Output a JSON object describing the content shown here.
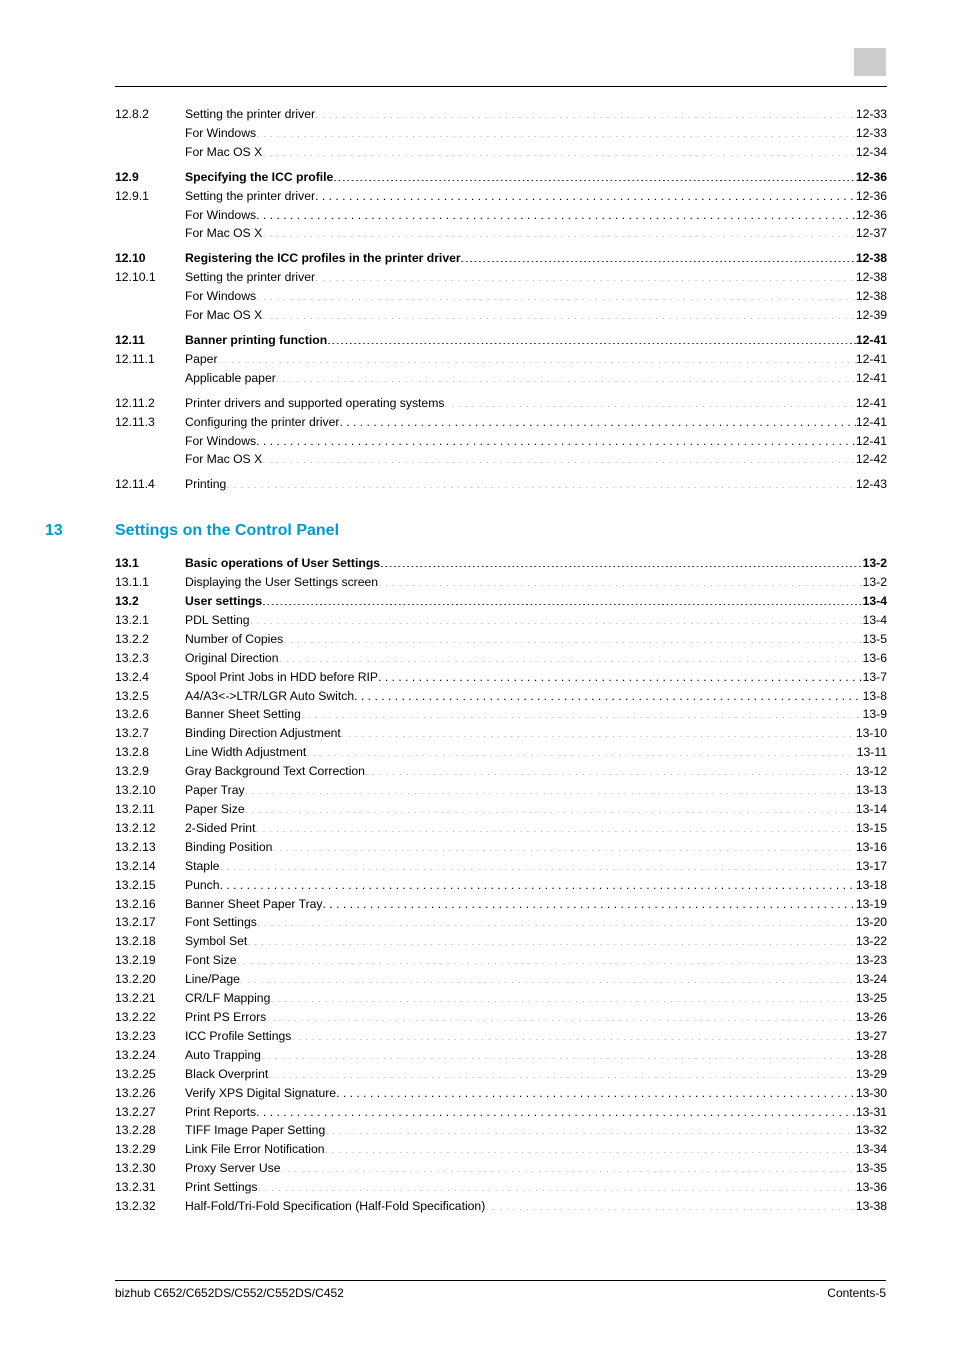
{
  "footer": {
    "product": "bizhub C652/C652DS/C552/C552DS/C452",
    "page": "Contents-5"
  },
  "section13": {
    "num": "13",
    "title": "Settings on the Control Panel"
  },
  "entries": [
    {
      "num": "12.8.2",
      "title": "Setting the printer driver",
      "pg": "12-33",
      "bold": false,
      "gapBefore": false
    },
    {
      "num": "",
      "title": "For Windows",
      "pg": "12-33",
      "bold": false
    },
    {
      "num": "",
      "title": "For Mac OS X",
      "pg": "12-34",
      "bold": false
    },
    {
      "num": "12.9",
      "title": "Specifying the ICC profile",
      "pg": "12-36",
      "bold": true,
      "gapBefore": true
    },
    {
      "num": "12.9.1",
      "title": "Setting the printer driver",
      "pg": "12-36",
      "bold": false
    },
    {
      "num": "",
      "title": "For Windows",
      "pg": "12-36",
      "bold": false
    },
    {
      "num": "",
      "title": "For Mac OS X",
      "pg": "12-37",
      "bold": false
    },
    {
      "num": "12.10",
      "title": "Registering the ICC profiles in the printer driver",
      "pg": "12-38",
      "bold": true,
      "gapBefore": true
    },
    {
      "num": "12.10.1",
      "title": "Setting the printer driver",
      "pg": "12-38",
      "bold": false
    },
    {
      "num": "",
      "title": "For Windows",
      "pg": "12-38",
      "bold": false
    },
    {
      "num": "",
      "title": "For Mac OS X",
      "pg": "12-39",
      "bold": false
    },
    {
      "num": "12.11",
      "title": "Banner printing function",
      "pg": "12-41",
      "bold": true,
      "gapBefore": true
    },
    {
      "num": "12.11.1",
      "title": "Paper",
      "pg": "12-41",
      "bold": false
    },
    {
      "num": "",
      "title": "Applicable paper",
      "pg": "12-41",
      "bold": false
    },
    {
      "num": "12.11.2",
      "title": "Printer drivers and supported operating systems",
      "pg": "12-41",
      "bold": false,
      "gapBefore": true
    },
    {
      "num": "12.11.3",
      "title": "Configuring the printer driver",
      "pg": "12-41",
      "bold": false
    },
    {
      "num": "",
      "title": "For Windows",
      "pg": "12-41",
      "bold": false
    },
    {
      "num": "",
      "title": "For Mac OS X",
      "pg": "12-42",
      "bold": false
    },
    {
      "num": "12.11.4",
      "title": "Printing",
      "pg": "12-43",
      "bold": false,
      "gapBefore": true
    }
  ],
  "entries13": [
    {
      "num": "13.1",
      "title": "Basic operations of User Settings",
      "pg": "13-2",
      "bold": true
    },
    {
      "num": "13.1.1",
      "title": "Displaying the User Settings screen",
      "pg": "13-2",
      "bold": false
    },
    {
      "num": "13.2",
      "title": "User settings",
      "pg": "13-4",
      "bold": true
    },
    {
      "num": "13.2.1",
      "title": "PDL Setting",
      "pg": "13-4",
      "bold": false
    },
    {
      "num": "13.2.2",
      "title": "Number of Copies",
      "pg": "13-5",
      "bold": false
    },
    {
      "num": "13.2.3",
      "title": "Original Direction",
      "pg": "13-6",
      "bold": false
    },
    {
      "num": "13.2.4",
      "title": "Spool Print Jobs in HDD before RIP",
      "pg": "13-7",
      "bold": false
    },
    {
      "num": "13.2.5",
      "title": "A4/A3<->LTR/LGR Auto Switch",
      "pg": "13-8",
      "bold": false
    },
    {
      "num": "13.2.6",
      "title": "Banner Sheet Setting",
      "pg": "13-9",
      "bold": false
    },
    {
      "num": "13.2.7",
      "title": "Binding Direction Adjustment",
      "pg": "13-10",
      "bold": false
    },
    {
      "num": "13.2.8",
      "title": "Line Width Adjustment",
      "pg": "13-11",
      "bold": false
    },
    {
      "num": "13.2.9",
      "title": "Gray Background Text Correction",
      "pg": "13-12",
      "bold": false
    },
    {
      "num": "13.2.10",
      "title": "Paper Tray",
      "pg": "13-13",
      "bold": false
    },
    {
      "num": "13.2.11",
      "title": "Paper Size",
      "pg": "13-14",
      "bold": false
    },
    {
      "num": "13.2.12",
      "title": "2-Sided Print",
      "pg": "13-15",
      "bold": false
    },
    {
      "num": "13.2.13",
      "title": "Binding Position",
      "pg": "13-16",
      "bold": false
    },
    {
      "num": "13.2.14",
      "title": "Staple",
      "pg": "13-17",
      "bold": false
    },
    {
      "num": "13.2.15",
      "title": "Punch",
      "pg": "13-18",
      "bold": false
    },
    {
      "num": "13.2.16",
      "title": "Banner Sheet Paper Tray",
      "pg": "13-19",
      "bold": false
    },
    {
      "num": "13.2.17",
      "title": "Font Settings",
      "pg": "13-20",
      "bold": false
    },
    {
      "num": "13.2.18",
      "title": "Symbol Set",
      "pg": "13-22",
      "bold": false
    },
    {
      "num": "13.2.19",
      "title": "Font Size",
      "pg": "13-23",
      "bold": false
    },
    {
      "num": "13.2.20",
      "title": "Line/Page",
      "pg": "13-24",
      "bold": false
    },
    {
      "num": "13.2.21",
      "title": "CR/LF Mapping",
      "pg": "13-25",
      "bold": false
    },
    {
      "num": "13.2.22",
      "title": "Print PS Errors",
      "pg": "13-26",
      "bold": false
    },
    {
      "num": "13.2.23",
      "title": "ICC Profile Settings",
      "pg": "13-27",
      "bold": false
    },
    {
      "num": "13.2.24",
      "title": "Auto Trapping",
      "pg": "13-28",
      "bold": false
    },
    {
      "num": "13.2.25",
      "title": "Black Overprint",
      "pg": "13-29",
      "bold": false
    },
    {
      "num": "13.2.26",
      "title": "Verify XPS Digital Signature",
      "pg": "13-30",
      "bold": false
    },
    {
      "num": "13.2.27",
      "title": "Print Reports",
      "pg": "13-31",
      "bold": false
    },
    {
      "num": "13.2.28",
      "title": "TIFF Image Paper Setting",
      "pg": "13-32",
      "bold": false
    },
    {
      "num": "13.2.29",
      "title": "Link File Error Notification",
      "pg": "13-34",
      "bold": false
    },
    {
      "num": "13.2.30",
      "title": "Proxy Server Use",
      "pg": "13-35",
      "bold": false
    },
    {
      "num": "13.2.31",
      "title": "Print Settings",
      "pg": "13-36",
      "bold": false
    },
    {
      "num": "13.2.32",
      "title": "Half-Fold/Tri-Fold Specification (Half-Fold Specification)",
      "pg": "13-38",
      "bold": false
    }
  ]
}
